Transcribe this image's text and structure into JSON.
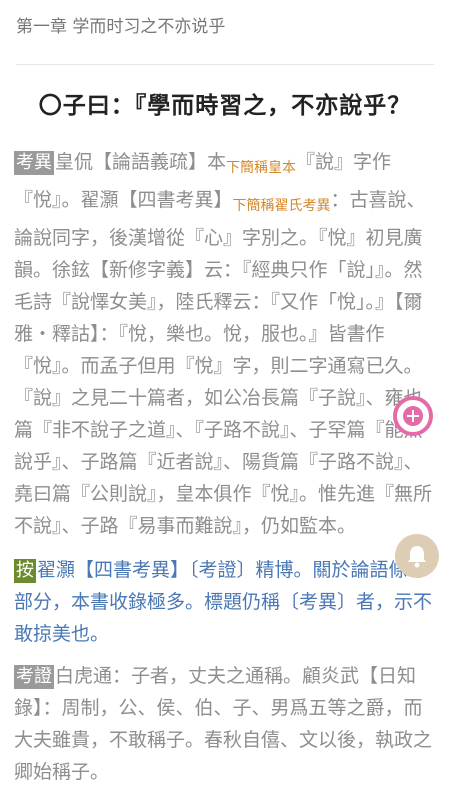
{
  "header": {
    "chapter_title": "第一章 学而时习之不亦说乎"
  },
  "article": {
    "heading": "〇子曰：『學而時習之，不亦說乎？",
    "p1": {
      "tag": "考異",
      "t1": "皇侃【論語義疏】本",
      "n1": "下簡稱皇本",
      "t2": "『說』字作『悅』。翟灝【四書考異】",
      "n2": "下簡稱翟氏考異",
      "t3": "：古喜說、論說同字，後漢增從『心』字別之。『悅』初見廣韻。徐鉉【新修字義】云：『經典只作「說」』。然毛詩『說懌女美』，陸氏釋云：『又作「悅」。』【爾雅・釋詁】：『悅，樂也。悅，服也。』皆書作『悅』。而孟子但用『悅』字，則二字通寫已久。『說』之見二十篇者，如公冶長篇『子說』、雍也篇『非不說子之道』、『子路不說』、子罕篇『能無說乎』、子路篇『近者說』、陽貨篇『子路不說』、堯曰篇『公則說』，皇本俱作『悅』。惟先進『無所不說』、子路『易事而難說』，仍如監本。"
    },
    "p2": {
      "tag": "按",
      "text": "翟灝【四書考異】〔考證〕精博。關於論語條考部分，本書收錄極多。標題仍稱〔考異〕者，示不敢掠美也。"
    },
    "p3": {
      "tag": "考證",
      "text": "白虎通：子者，丈夫之通稱。顧炎武【日知錄】：周制，公、侯、伯、子、男爲五等之爵，而大夫雖貴，不敢稱子。春秋自僖、文以後，執政之卿始稱子。"
    }
  },
  "icons": {
    "add": "add-circle-icon",
    "bell": "bell-icon"
  },
  "colors": {
    "tag_grey": "#9a9a9a",
    "tag_green": "#6c8b2e",
    "note": "#d4882a",
    "blue_text": "#4a78b5",
    "fab_pink": "#e56aa8",
    "fab_beige": "#ddcdb5"
  }
}
